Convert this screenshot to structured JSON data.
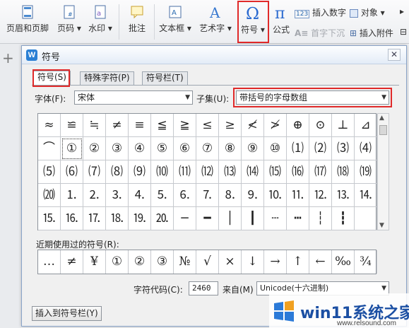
{
  "ribbon": {
    "header_footer": "页眉和页脚",
    "page_number": "页码",
    "watermark": "水印",
    "annotate": "批注",
    "textbox": "文本框",
    "art_text": "艺术字",
    "symbol": "符号",
    "formula": "公式",
    "insert_number": "插入数字",
    "object": "对象",
    "drop_cap": "首字下沉",
    "attachment": "插入附件"
  },
  "dialog": {
    "title": "符号",
    "close": "✕",
    "tabs": [
      "符号(S)",
      "特殊字符(P)",
      "符号栏(T)"
    ],
    "font_label": "字体(F):",
    "font_value": "宋体",
    "subset_label": "子集(U):",
    "subset_value": "带括号的字母数组",
    "grid": [
      [
        "≈",
        "≌",
        "≒",
        "≠",
        "≡",
        "≦",
        "≧",
        "≤",
        "≥",
        "≮",
        "≯",
        "⊕",
        "⊙",
        "⊥",
        "⊿"
      ],
      [
        "⌒",
        "①",
        "②",
        "③",
        "④",
        "⑤",
        "⑥",
        "⑦",
        "⑧",
        "⑨",
        "⑩",
        "⑴",
        "⑵",
        "⑶",
        "⑷"
      ],
      [
        "⑸",
        "⑹",
        "⑺",
        "⑻",
        "⑼",
        "⑽",
        "⑾",
        "⑿",
        "⒀",
        "⒁",
        "⒂",
        "⒃",
        "⒄",
        "⒅",
        "⒆"
      ],
      [
        "⒇",
        "⒈",
        "⒉",
        "⒊",
        "⒋",
        "⒌",
        "⒍",
        "⒎",
        "⒏",
        "⒐",
        "⒑",
        "⒒",
        "⒓",
        "⒔",
        "⒕"
      ],
      [
        "⒖",
        "⒗",
        "⒘",
        "⒙",
        "⒚",
        "⒛",
        "─",
        "━",
        "│",
        "┃",
        "┄",
        "┅",
        "┆",
        "┇",
        ""
      ]
    ],
    "recent_label": "近期使用过的符号(R):",
    "recent": [
      "…",
      "≠",
      "¥",
      "①",
      "②",
      "③",
      "№",
      "√",
      "×",
      "↓",
      "→",
      "↑",
      "←",
      "‰",
      "¾"
    ],
    "charcode_label": "字符代码(C):",
    "charcode_value": "2460",
    "from_label": "来自(M)",
    "from_value": "Unicode(十六进制)",
    "insert_bar_button": "插入到符号栏(Y)"
  },
  "watermark": {
    "brand": "win11系统之家",
    "url": "www.relsound.com"
  },
  "colors": {
    "highlight": "#e02a2a",
    "brand_blue": "#1b4fa3"
  }
}
